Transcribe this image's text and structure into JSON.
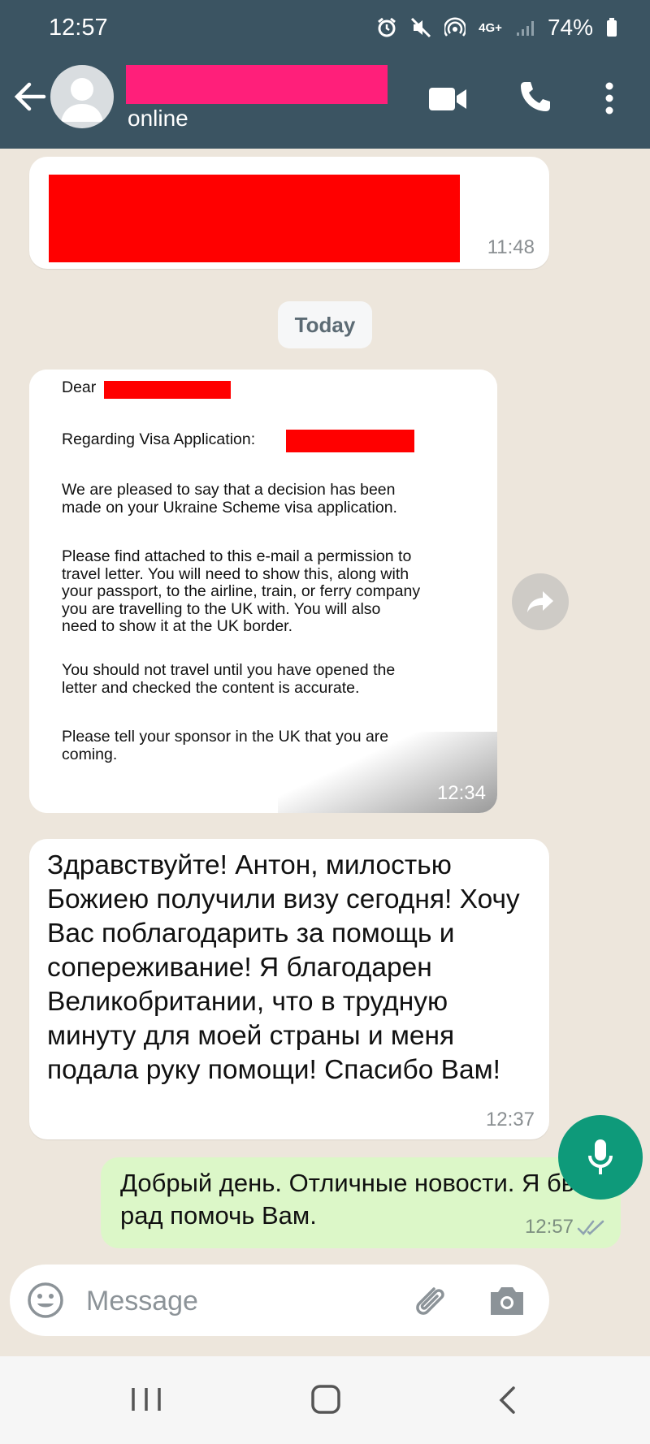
{
  "status_bar": {
    "time": "12:57",
    "network": "4G+",
    "battery": "74%",
    "icons": [
      "alarm-icon",
      "mute-icon",
      "hotspot-icon",
      "signal-icon",
      "battery-icon"
    ]
  },
  "header": {
    "presence": "online",
    "contact_name_redacted": true,
    "redaction_color": "#ff1f7a",
    "bg_color": "#3b5462",
    "actions": [
      "back-icon",
      "video-call-icon",
      "phone-icon",
      "more-options-icon"
    ]
  },
  "messages": [
    {
      "type": "incoming_redacted",
      "time": "11:48"
    },
    {
      "type": "date_chip",
      "label": "Today"
    },
    {
      "type": "incoming_image",
      "time": "12:34",
      "document": {
        "dear": "Dear",
        "regarding": "Regarding Visa Application:",
        "p1": "We are pleased to say that a decision has been\nmade on your Ukraine Scheme visa application.",
        "p2": "Please find attached to this e-mail a permission to\ntravel letter.  You will need to show this, along with\nyour passport, to the airline, train, or ferry company\nyou are travelling to the UK with.  You will also\nneed to show it at the UK border.",
        "p3": "You should not travel until you have opened the\nletter and checked the content is accurate.",
        "p4": "Please tell your sponsor in the UK that you are\ncoming."
      }
    },
    {
      "type": "incoming_text",
      "time": "12:37",
      "text": "Здравствуйте! Антон, милостью Божиею получили визу сегодня! Хочу Вас поблагодарить за помощь и сопереживание! Я благодарен Великобритании, что в трудную минуту для моей страны и меня подала руку помощи! Спасибо Вам!"
    },
    {
      "type": "outgoing_text",
      "time": "12:57",
      "text": "Добрый день. Отличные новости. Я был рад помочь Вам.",
      "status": "read",
      "bubble_color": "#dcf7c8"
    }
  ],
  "composer": {
    "placeholder": "Message",
    "mic_color": "#0e9a7a"
  },
  "navbar": [
    "recents-icon",
    "home-icon",
    "back-nav-icon"
  ]
}
